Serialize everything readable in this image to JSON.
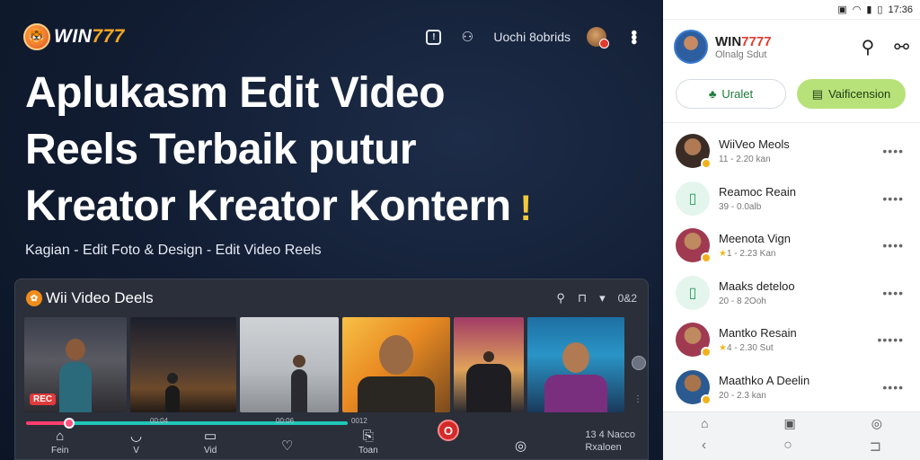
{
  "brand": {
    "badge": "🐯",
    "name_main": "WIN",
    "name_accent": "777"
  },
  "topbar": {
    "square_icon": "square-badge-icon",
    "share_icon": "share-icon",
    "link_label": "Uochi 8obrids",
    "avatar": "user-avatar",
    "menu_icon": "kebab-menu-icon"
  },
  "headline": {
    "line1": "Aplukasm Edit Video",
    "line2": "Reels Terbaik putur",
    "line3": "Kreator Kreator Kontern",
    "bolt": "!"
  },
  "subline": "Kagian - Edit Foto & Design  - Edit Video Reels",
  "editor": {
    "title": "Wii Video Deels",
    "counter": "0&2",
    "rec_badge": "REC",
    "timeline_labels": [
      "00:04",
      "00:06",
      "0012"
    ],
    "nav": [
      {
        "icon": "⌂",
        "label": "Fein"
      },
      {
        "icon": "◡",
        "label": "V"
      },
      {
        "icon": "▭",
        "label": "Vid"
      },
      {
        "icon": "♡",
        "label": ""
      },
      {
        "icon": "⎘",
        "label": "Toan"
      },
      {
        "icon": "◎",
        "label": ""
      }
    ],
    "record_label": "O",
    "note_line1": "13 4 Nacco",
    "note_line2": "Rxaloen"
  },
  "phone": {
    "status_time": "17:36",
    "title_main": "WIN",
    "title_accent": "7777",
    "subtitle": "Olnalg Sdut",
    "tab_left": "Uralet",
    "tab_right": "Vaificension",
    "rows": [
      {
        "title": "WiiVeo Meols",
        "meta": "11 - 2.20 kan",
        "star": ""
      },
      {
        "title": "Reamoc Reain",
        "meta": "39 - 0.0alb",
        "star": ""
      },
      {
        "title": "Meenota Vign",
        "meta": "1 - 2.23 Kan",
        "star": "★"
      },
      {
        "title": "Maaks deteloo",
        "meta": "20 - 8 2Ooh",
        "star": ""
      },
      {
        "title": "Mantko Resain",
        "meta": "4 - 2.30 Sut",
        "star": "★"
      },
      {
        "title": "Maathko A Deelin",
        "meta": "20 - 2.3 kan",
        "star": ""
      }
    ],
    "nav_top": [
      "⌂",
      "▣",
      "◎"
    ],
    "nav_bottom": [
      "‹",
      "○",
      "⊐"
    ]
  }
}
